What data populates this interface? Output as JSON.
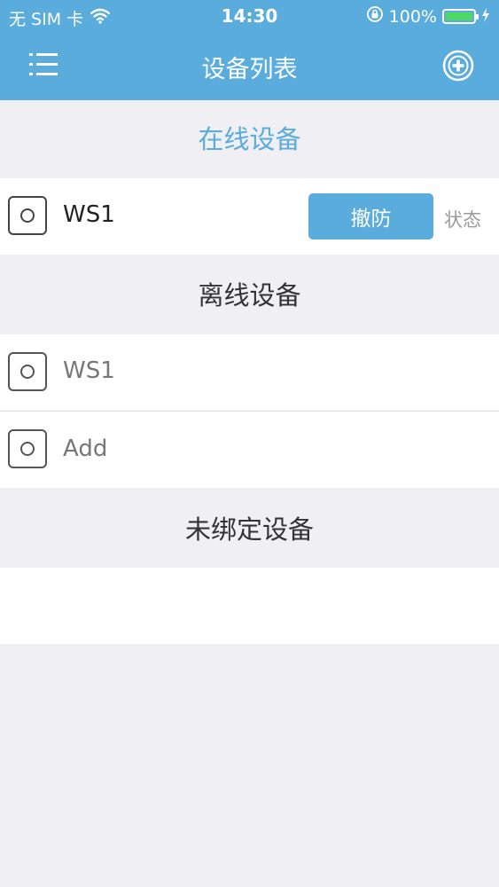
{
  "status_bar": {
    "carrier": "无 SIM 卡",
    "time": "14:30",
    "battery_percent": "100%",
    "battery_level": 1.0
  },
  "nav": {
    "title": "设备列表",
    "menu_icon": "list-menu-icon",
    "add_icon": "add-circle-icon"
  },
  "sections": {
    "online": {
      "title": "在线设备",
      "devices": [
        {
          "name": "WS1",
          "action_label": "撤防",
          "status_label": "状态"
        }
      ]
    },
    "offline": {
      "title": "离线设备",
      "devices": [
        {
          "name": "WS1"
        },
        {
          "name": "Add"
        }
      ]
    },
    "unbound": {
      "title": "未绑定设备"
    }
  },
  "colors": {
    "accent": "#5aacdc",
    "background": "#efeff4",
    "battery": "#4cd964"
  }
}
